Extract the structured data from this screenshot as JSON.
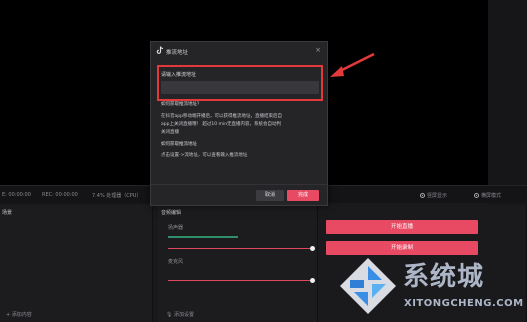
{
  "status": {
    "left_time": "E: 00:00:00",
    "rec_time": "REC: 00:00:00",
    "cpu": "7.4% 处理器（CPU）",
    "radio_1": "竖屏显示",
    "radio_2": "横屏模式"
  },
  "panels": {
    "scenes_title": "场景",
    "scenes_add": "+ 添加内容",
    "audio_title": "音频编辑",
    "audio_track_1": "扬声器",
    "audio_track_2": "麦克风",
    "audio_footer": "添加设置",
    "start_live": "开始直播",
    "start_record": "开始录制"
  },
  "dialog": {
    "title": "推流地址",
    "close": "×",
    "input_label": "请输入推流地址",
    "input_value": "",
    "help_title": "如何获取推流地址？",
    "help_line_1": "在抖音app移动端开播后，可以获得推流地址，直播结束后自",
    "help_line_2": "app上关闭直播哦！ 超过10 min无直播内容，系统会自动判",
    "help_line_3": "关闭直播",
    "help_title_2": "如何获取推流地址",
    "help_line_4": "点击设置->流地址，可以查看输入推流地址",
    "cancel": "取消",
    "confirm": "完成"
  },
  "watermark": {
    "brand": "系统城",
    "site": "XITONGCHENG.COM"
  },
  "colors": {
    "accent": "#e84a63",
    "highlight": "#e23a3a",
    "meter": "#2e8f6a"
  }
}
